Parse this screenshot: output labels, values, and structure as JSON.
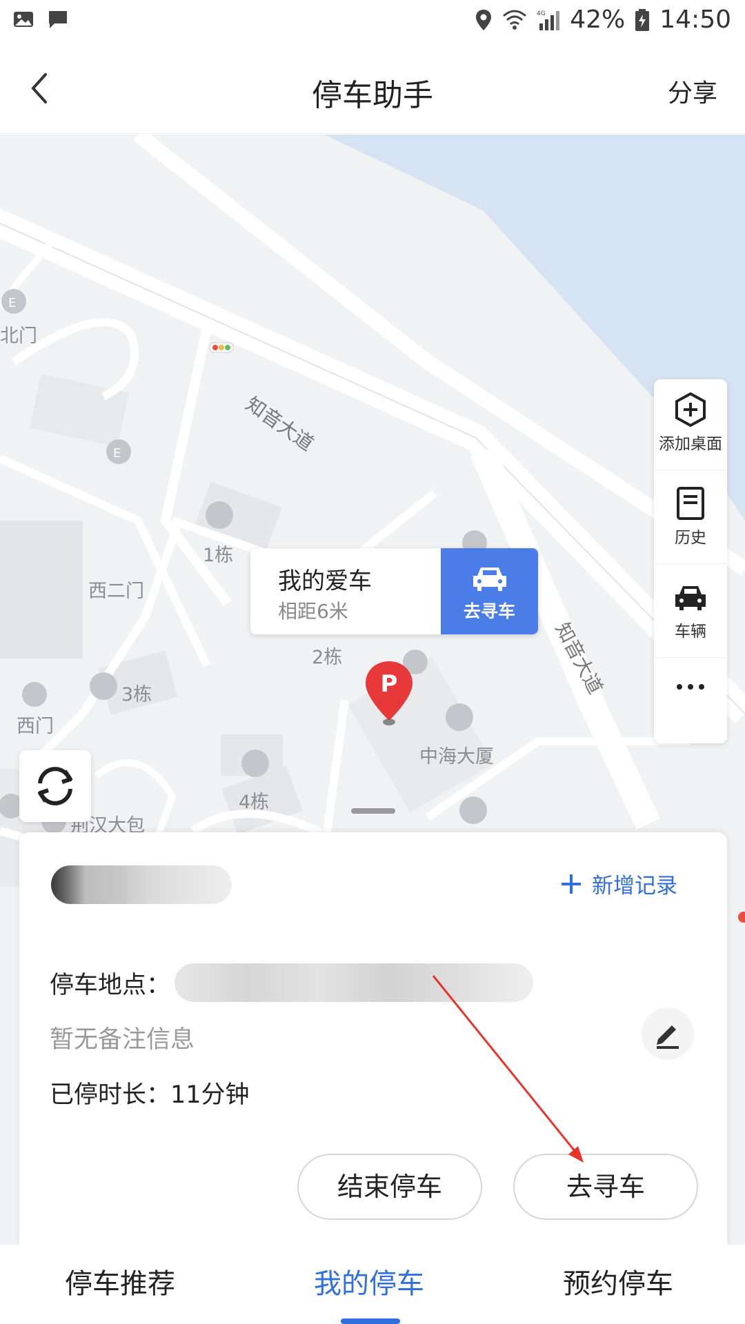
{
  "status_bar": {
    "battery": "42%",
    "time": "14:50",
    "network": "4G"
  },
  "header": {
    "title": "停车助手",
    "share_label": "分享"
  },
  "map": {
    "labels": {
      "north_gate": "北门",
      "west_gate_2": "西二门",
      "west_gate": "西门",
      "building_1": "1栋",
      "building_2": "2栋",
      "building_3": "3栋",
      "building_4": "4栋",
      "zhonghai": "中海大厦",
      "jinghan": "荆汉大包"
    },
    "roads": {
      "road_1": "知音大道",
      "road_2": "知音大道"
    },
    "toolbar": [
      {
        "label": "添加桌面",
        "icon": "add-hexagon-icon"
      },
      {
        "label": "历史",
        "icon": "history-icon"
      },
      {
        "label": "车辆",
        "icon": "car-icon"
      },
      {
        "label": "",
        "icon": "more-icon"
      }
    ],
    "callout": {
      "name": "我的爱车",
      "distance": "相距6米",
      "go_label": "去寻车"
    },
    "pin_letter": "P"
  },
  "sheet": {
    "add_record": "新增记录",
    "location_label": "停车地点：",
    "note": "暂无备注信息",
    "duration": "已停时长：11分钟",
    "end_button": "结束停车",
    "find_button": "去寻车"
  },
  "tabs": [
    {
      "label": "停车推荐",
      "active": false
    },
    {
      "label": "我的停车",
      "active": true
    },
    {
      "label": "预约停车",
      "active": false
    }
  ],
  "colors": {
    "accent": "#2f6fe0",
    "callout_blue": "#4a7de8",
    "pin_red": "#e8393a",
    "water": "#d6e3f3",
    "annotation_red": "#e8332a"
  }
}
